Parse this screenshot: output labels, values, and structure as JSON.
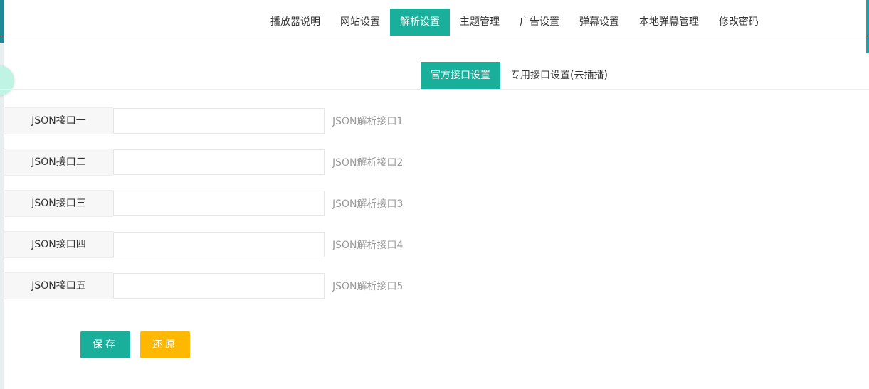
{
  "top_nav": {
    "tabs": [
      {
        "label": "播放器说明"
      },
      {
        "label": "网站设置"
      },
      {
        "label": "解析设置"
      },
      {
        "label": "主题管理"
      },
      {
        "label": "广告设置"
      },
      {
        "label": "弹幕设置"
      },
      {
        "label": "本地弹幕管理"
      },
      {
        "label": "修改密码"
      }
    ],
    "active_index": 2
  },
  "sub_nav": {
    "tabs": [
      {
        "label": "官方接口设置"
      },
      {
        "label": "专用接口设置(去插播)"
      }
    ],
    "active_index": 0
  },
  "form": {
    "rows": [
      {
        "label": "JSON接口一",
        "value": "",
        "hint": "JSON解析接口1"
      },
      {
        "label": "JSON接口二",
        "value": "",
        "hint": "JSON解析接口2"
      },
      {
        "label": "JSON接口三",
        "value": "",
        "hint": "JSON解析接口3"
      },
      {
        "label": "JSON接口四",
        "value": "",
        "hint": "JSON解析接口4"
      },
      {
        "label": "JSON接口五",
        "value": "",
        "hint": "JSON解析接口5"
      }
    ],
    "save_label": "保存",
    "reset_label": "还原"
  },
  "colors": {
    "accent": "#1aaf9b",
    "warning": "#ffb800"
  }
}
